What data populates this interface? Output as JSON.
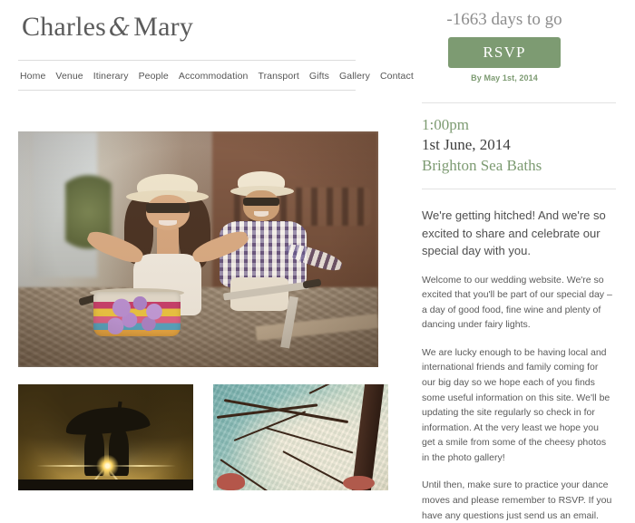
{
  "site": {
    "title_first": "Charles",
    "title_amp": "&",
    "title_second": "Mary"
  },
  "nav": {
    "items": [
      {
        "label": "Home"
      },
      {
        "label": "Venue"
      },
      {
        "label": "Itinerary"
      },
      {
        "label": "People"
      },
      {
        "label": "Accommodation"
      },
      {
        "label": "Transport"
      },
      {
        "label": "Gifts"
      },
      {
        "label": "Gallery"
      },
      {
        "label": "Contact"
      }
    ]
  },
  "countdown": {
    "text": "-1663 days to go"
  },
  "rsvp": {
    "label": "RSVP",
    "note": "By May 1st, 2014",
    "color": "#7d9b72"
  },
  "event": {
    "time": "1:00pm",
    "date": "1st June, 2014",
    "venue": "Brighton Sea Baths",
    "accent_color": "#7d9b72"
  },
  "content": {
    "lead": "We're getting hitched! And we're so excited to share and celebrate our special day with you.",
    "paragraphs": [
      "Welcome to our wedding website. We're so excited that you'll be part of our special day – a day of good food, fine wine and plenty of dancing under fairy lights.",
      "We are lucky enough to be having local and international friends and family coming for our big day so we hope each of you finds some useful information on this site. We'll be updating the site regularly so check in for information. At the very least we hope you get a smile from some of the cheesy photos in the photo gallery!",
      "Until then, make sure to practice your dance moves and please remember to RSVP. If you have any questions just send us an email."
    ]
  },
  "gallery": {
    "hero": {
      "name": "couple-on-bicycle-photo"
    },
    "thumbs": [
      {
        "name": "couple-under-umbrella-photo"
      },
      {
        "name": "tree-branches-photo"
      }
    ]
  }
}
